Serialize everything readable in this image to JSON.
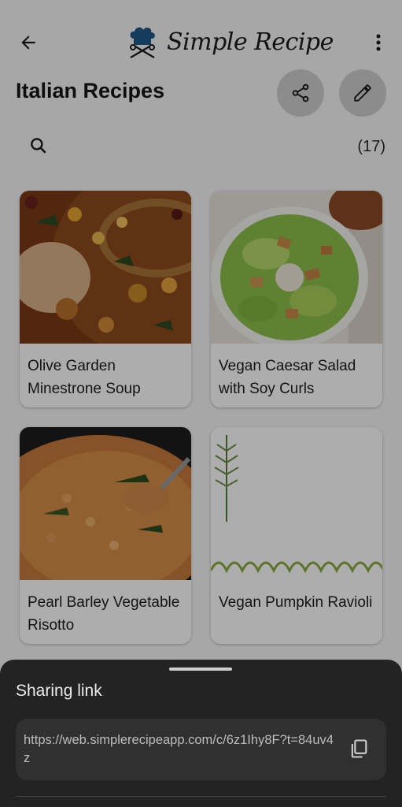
{
  "header": {
    "app_name": "Simple Recipe",
    "page_title": "Italian Recipes",
    "recipe_count": "(17)"
  },
  "icons": {
    "back": "arrow-left",
    "menu": "more-vertical",
    "share": "share",
    "edit": "pencil",
    "search": "search",
    "copy": "copy"
  },
  "recipes": [
    {
      "title": "Olive Garden Minestrone Soup"
    },
    {
      "title": "Vegan Caesar Salad with Soy Curls"
    },
    {
      "title": "Pearl Barley Vegetable Risotto"
    },
    {
      "title": "Vegan Pumpkin Ravioli"
    }
  ],
  "sheet": {
    "title": "Sharing link",
    "link": "https://web.simplerecipeapp.com/c/6z1Ihy8F?t=84uv4z"
  },
  "colors": {
    "sheet_bg": "#222322",
    "link_box_bg": "#2f302f",
    "accent": "#1f5a86"
  }
}
